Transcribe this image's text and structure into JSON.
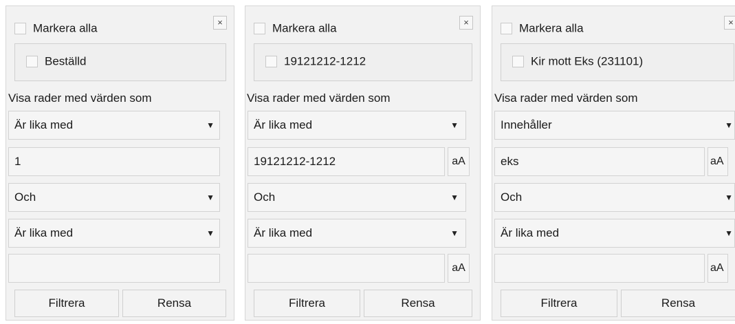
{
  "panels": [
    {
      "close_glyph": "×",
      "select_all_label": "Markera alla",
      "list_item": "Beställd",
      "caption": "Visa rader med värden som",
      "op1": "Är lika med",
      "value1": "1",
      "logic": "Och",
      "op2": "Är lika med",
      "value2": "",
      "filter_label": "Filtrera",
      "clear_label": "Rensa"
    },
    {
      "close_glyph": "×",
      "select_all_label": "Markera alla",
      "list_item": "19121212-1212",
      "caption": "Visa rader med värden som",
      "op1": "Är lika med",
      "value1": "19121212-1212",
      "case_label": "aA",
      "logic": "Och",
      "op2": "Är lika med",
      "value2": "",
      "filter_label": "Filtrera",
      "clear_label": "Rensa"
    },
    {
      "close_glyph": "×",
      "select_all_label": "Markera alla",
      "list_item": "Kir mott Eks (231101)",
      "caption": "Visa rader med värden som",
      "op1": "Innehåller",
      "value1": "eks",
      "case_label": "aA",
      "logic": "Och",
      "op2": "Är lika med",
      "value2": "",
      "filter_label": "Filtrera",
      "clear_label": "Rensa"
    }
  ],
  "icons": {
    "dropdown_arrow": "▼"
  }
}
